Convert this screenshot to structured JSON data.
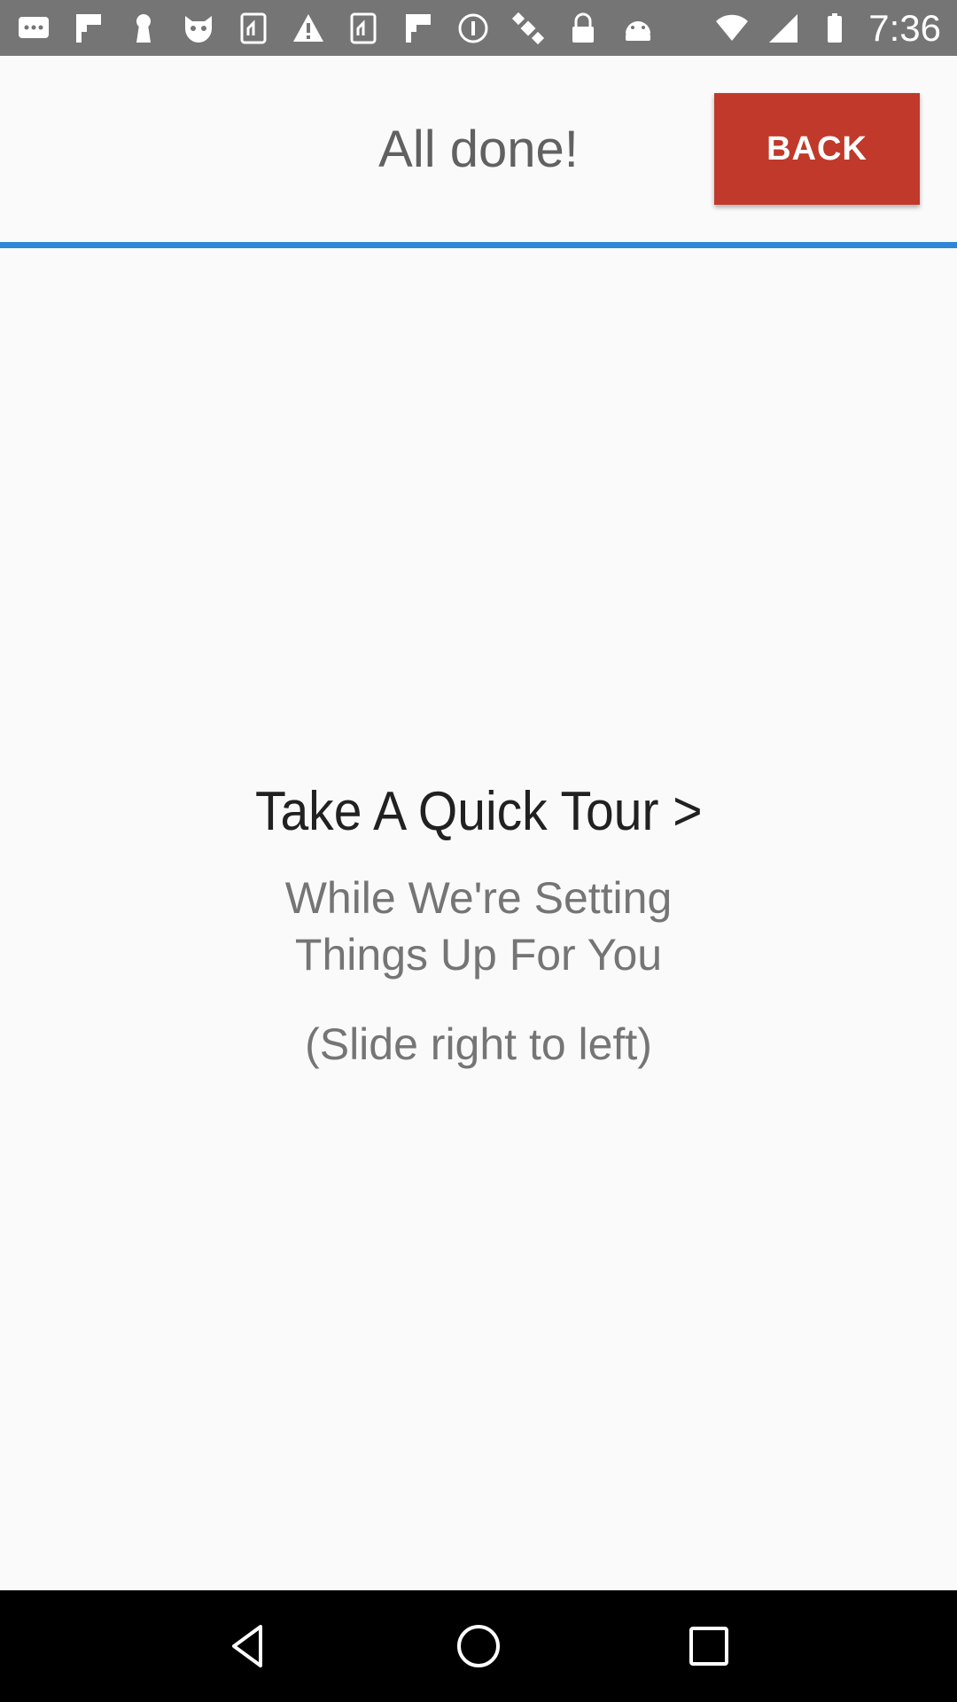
{
  "status_bar": {
    "time": "7:36",
    "icons": [
      "messages-icon",
      "flipboard-icon",
      "keyhole-icon",
      "cat-app-icon",
      "subway-icon",
      "warning-icon",
      "subway-icon",
      "flipboard-icon",
      "info-icon",
      "satellite-icon",
      "lock-icon",
      "android-icon"
    ]
  },
  "header": {
    "title": "All done!",
    "back_label": "BACK"
  },
  "content": {
    "tour_title": "Take A Quick Tour >",
    "subtitle_line1": "While We're Setting",
    "subtitle_line2": "Things Up For You",
    "hint": "(Slide right to left)"
  },
  "colors": {
    "status_bar": "#757575",
    "back_button": "#c0392b",
    "divider": "#2f86d8",
    "background": "#fafafa"
  }
}
